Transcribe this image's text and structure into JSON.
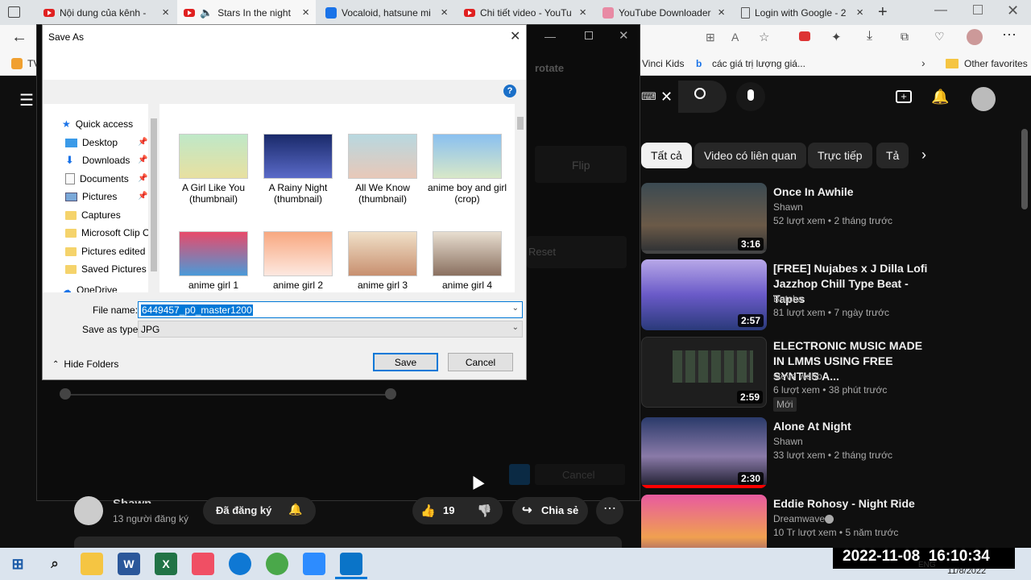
{
  "browser": {
    "tabs": [
      {
        "title": "Nội dung của kênh -",
        "icon": "youtube-icon"
      },
      {
        "title": "Stars In the night",
        "icon": "youtube-icon"
      },
      {
        "title": "Vocaloid, hatsune mi",
        "icon": "pixiv-icon"
      },
      {
        "title": "Chi tiết video - YouTu",
        "icon": "youtube-icon"
      },
      {
        "title": "YouTube Downloader",
        "icon": "downloader-icon"
      },
      {
        "title": "Login with Google - 2",
        "icon": "document-icon"
      }
    ],
    "favorites": [
      {
        "label": "TV"
      },
      {
        "label": "Vinci Kids"
      },
      {
        "label": "các giá trị lượng giá..."
      },
      {
        "label": "Other favorites"
      }
    ]
  },
  "youtube": {
    "chips": [
      "Tất cả",
      "Video có liên quan",
      "Trực tiếp",
      "Tả"
    ],
    "videos": [
      {
        "title": "Once In Awhile",
        "channel": "Shawn",
        "meta": "52 lượt xem  •  2 tháng trước",
        "duration": "3:16",
        "badge": ""
      },
      {
        "title": "[FREE] Nujabes x J Dilla Lofi Jazzhop Chill Type Beat - Tapes",
        "channel": "Butcha",
        "meta": "81 lượt xem  •  7 ngày trước",
        "duration": "2:57",
        "badge": ""
      },
      {
        "title": "ELECTRONIC MUSIC MADE IN LMMS USING FREE SYNTHS A...",
        "channel": "steve webb",
        "meta": "6 lượt xem  •  38 phút trước",
        "duration": "2:59",
        "badge": "Mới"
      },
      {
        "title": "Alone At Night",
        "channel": "Shawn",
        "meta": "33 lượt xem  •  2 tháng trước",
        "duration": "2:30",
        "badge": ""
      },
      {
        "title": "Eddie Rohosy - Night Ride",
        "channel": "Dreamwave",
        "meta": "10 Tr lượt xem  •  5 năm trước",
        "duration": "",
        "badge": ""
      }
    ],
    "channel": {
      "name": "Shawn",
      "subs": "13 người đăng ký",
      "subscribed": "Đã đăng ký"
    },
    "actions": {
      "likes": "19",
      "share": "Chia sẻ"
    }
  },
  "editor": {
    "rotate": "rotate",
    "flip": "Flip",
    "reset": "Reset",
    "cancel": "Cancel"
  },
  "dialog": {
    "title": "Save As",
    "nav": [
      {
        "label": "Quick access",
        "icon": "star-icon",
        "pinned": false
      },
      {
        "label": "Desktop",
        "icon": "desktop-icon",
        "pinned": true
      },
      {
        "label": "Downloads",
        "icon": "download-icon",
        "pinned": true
      },
      {
        "label": "Documents",
        "icon": "documents-icon",
        "pinned": true
      },
      {
        "label": "Pictures",
        "icon": "pictures-icon",
        "pinned": true
      },
      {
        "label": "Captures",
        "icon": "folder-icon",
        "pinned": false
      },
      {
        "label": "Microsoft Clip O",
        "icon": "folder-icon",
        "pinned": false
      },
      {
        "label": "Pictures edited",
        "icon": "folder-icon",
        "pinned": false
      },
      {
        "label": "Saved Pictures",
        "icon": "folder-icon",
        "pinned": false
      },
      {
        "label": "OneDrive",
        "icon": "cloud-icon",
        "pinned": false
      }
    ],
    "files": [
      {
        "name": "A Girl Like You (thumbnail)",
        "color": "#a8d8b0"
      },
      {
        "name": "A Rainy Night (thumbnail)",
        "color": "#3a4a9a"
      },
      {
        "name": "All We Know (thumbnail)",
        "color": "#8fb6c8"
      },
      {
        "name": "anime boy and girl (crop)",
        "color": "#6fa8d8"
      },
      {
        "name": "anime girl 1",
        "color": "#d8526a"
      },
      {
        "name": "anime girl 2",
        "color": "#f0b090"
      },
      {
        "name": "anime girl 3",
        "color": "#e8d0b0"
      },
      {
        "name": "anime girl 4",
        "color": "#c0a890"
      }
    ],
    "file_name_label": "File name:",
    "file_name_value": "6449457_p0_master1200",
    "save_type_label": "Save as type:",
    "save_type_value": "JPG",
    "hide_folders": "Hide Folders",
    "save": "Save",
    "cancel": "Cancel"
  },
  "clock": {
    "overlay": "2022-11-08  16:10:34",
    "lang": "ENG",
    "date": "11/8/2022"
  }
}
